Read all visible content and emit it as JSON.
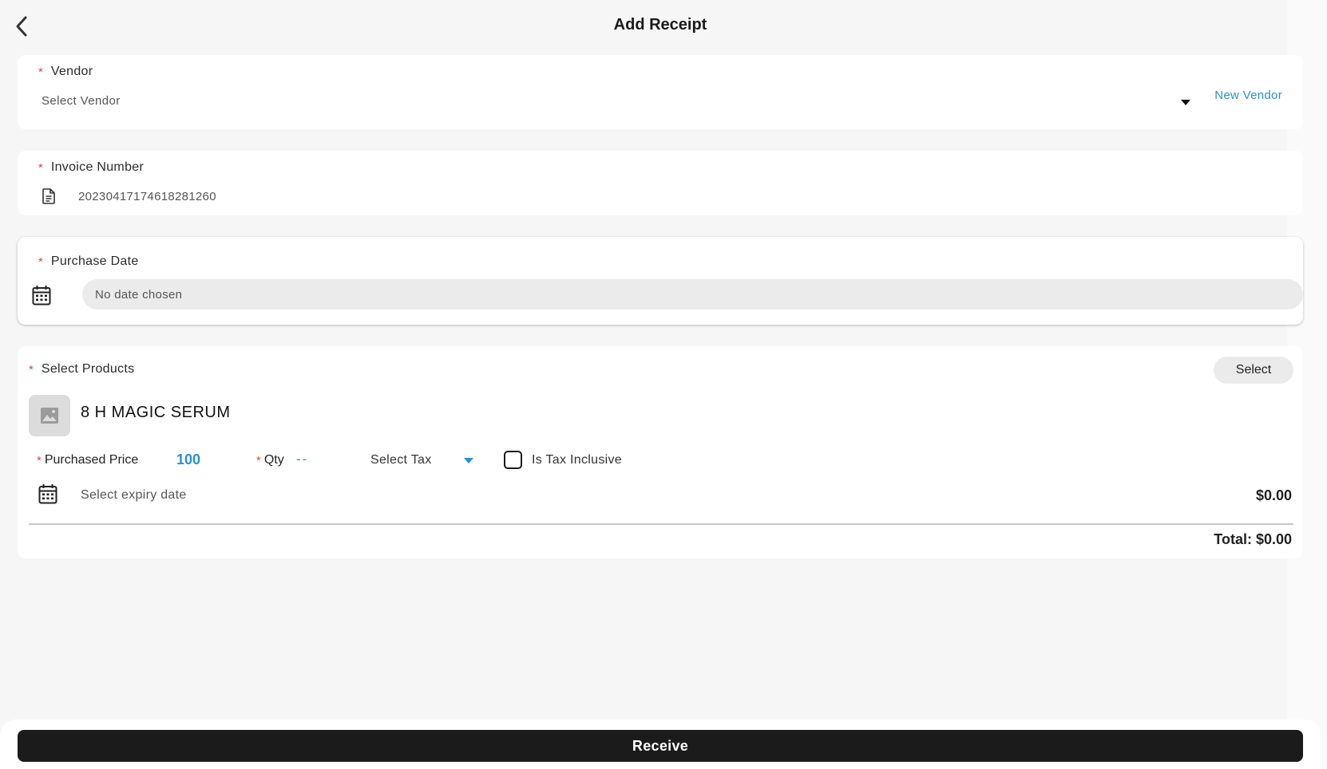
{
  "header": {
    "title": "Add Receipt"
  },
  "vendor": {
    "required_mark": "*",
    "label": "Vendor",
    "placeholder": "Select Vendor",
    "new_vendor_label": "New Vendor"
  },
  "invoice": {
    "required_mark": "*",
    "label": "Invoice Number",
    "value": "20230417174618281260"
  },
  "purchase_date": {
    "required_mark": "*",
    "label": "Purchase Date",
    "placeholder": "No date chosen"
  },
  "products": {
    "required_mark": "*",
    "label": "Select Products",
    "select_button": "Select",
    "items": [
      {
        "name": "8 H MAGIC SERUM",
        "price_required_mark": "*",
        "price_label": "Purchased Price",
        "price_value": "100",
        "qty_required_mark": "*",
        "qty_label": "Qty",
        "qty_value": "--",
        "tax_placeholder": "Select Tax",
        "tax_inclusive_label": "Is Tax Inclusive",
        "tax_inclusive_checked": false,
        "expiry_placeholder": "Select expiry date",
        "line_total": "$0.00"
      }
    ],
    "total": "Total: $0.00"
  },
  "footer": {
    "receive_label": "Receive"
  },
  "colors": {
    "accent": "#2a8fd6",
    "required": "#e0473d",
    "primary_button": "#1b1b1b",
    "background": "#f6f6f6"
  },
  "icons": {
    "back": "chevron-left-icon",
    "vendor_dropdown": "caret-down-icon",
    "invoice": "document-icon",
    "purchase_date": "calendar-icon",
    "product_thumb": "image-placeholder-icon",
    "tax_dropdown": "caret-down-icon",
    "expiry": "calendar-icon"
  }
}
